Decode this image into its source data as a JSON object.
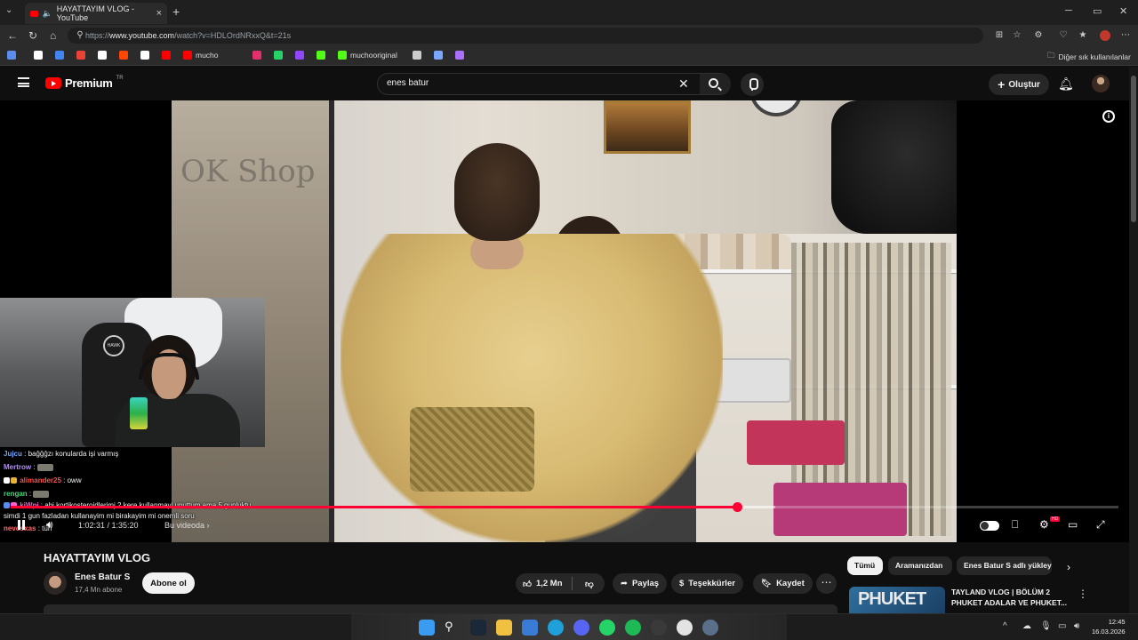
{
  "browser": {
    "tab_title": "HAYATTAYIM VLOG - YouTube",
    "url_prefix": "https://",
    "url_host": "www.youtube.com",
    "url_path": "/watch?v=HDLOrdNRxxQ&t=21s",
    "other_bookmarks": "Diğer sık kullanılanlar",
    "bookmarks": [
      {
        "label": "",
        "color": "#5a8dee"
      },
      {
        "label": "",
        "color": "#ffffff"
      },
      {
        "label": "",
        "color": "#4285f4"
      },
      {
        "label": "",
        "color": "#ea4335"
      },
      {
        "label": "",
        "color": "#ffffff"
      },
      {
        "label": "",
        "color": "#ff4500"
      },
      {
        "label": "",
        "color": "#ffffff"
      },
      {
        "label": "",
        "color": "#ff0000"
      },
      {
        "label": "mucho",
        "color": "#ff0000"
      },
      {
        "label": "",
        "color": "#e1306c"
      },
      {
        "label": "",
        "color": "#25d366"
      },
      {
        "label": "",
        "color": "#9146ff"
      },
      {
        "label": "",
        "color": "#53fc18"
      },
      {
        "label": "muchooriginal",
        "color": "#53fc18"
      },
      {
        "label": "",
        "color": "#cccccc"
      },
      {
        "label": "",
        "color": "#7aa7ff"
      },
      {
        "label": "",
        "color": "#a970ff"
      }
    ]
  },
  "youtube": {
    "logo_text": "Premium",
    "region": "TR",
    "search_value": "enes batur",
    "create_label": "Oluştur"
  },
  "player": {
    "current_time": "1:02:31",
    "duration": "1:35:20",
    "time_display": "1:02:31 / 1:35:20",
    "chapter_label": "Bu videoda",
    "played_fraction": 0.656,
    "buffered_fraction": 0.69,
    "shop_sign": "OK Shop"
  },
  "stream_overlay": {
    "chair_brand": "HAWK",
    "chat": [
      {
        "user": "Jujcu",
        "color": "#6fa8ff",
        "message": "bağğğzı konularda işi varmış",
        "emote": false
      },
      {
        "user": "Mertrow",
        "color": "#b48cff",
        "message": "",
        "emote": true
      },
      {
        "user": "alimander25",
        "color": "#ff4d4d",
        "message": "oww",
        "emote": false
      },
      {
        "user": "rengan",
        "color": "#4cd37c",
        "message": "",
        "emote": true
      },
      {
        "user": "kiWpi",
        "color": "#ff5fd2",
        "message": "abi kortikosteroidlerimj 2 kere kullanmayi unuttum ama 5 gunluktu simdi 1 gun fazladan kullanayim mi birakayim mi onemli soru",
        "emote": false
      },
      {
        "user": "nevosxas",
        "color": "#ff6b6b",
        "message": "tün",
        "emote": false
      }
    ]
  },
  "video": {
    "title": "HAYATTAYIM VLOG",
    "channel_name": "Enes Batur S",
    "subscribers": "17,4 Mn abone",
    "subscribe_label": "Abone ol",
    "likes": "1,2 Mn",
    "share_label": "Paylaş",
    "thanks_label": "Teşekkürler",
    "save_label": "Kaydet"
  },
  "sidebar": {
    "chips": [
      "Tümü",
      "Aramanızdan",
      "Enes Batur S adlı yükleyi"
    ],
    "recommended": {
      "thumb_text": "PHUKET",
      "title": "TAYLAND VLOG | BÖLÜM 2 PHUKET ADALAR VE PHUKET..."
    }
  },
  "taskbar": {
    "time": "12:45",
    "date": "16.03.2026",
    "apps": [
      {
        "name": "windows-start",
        "color": "#3a9bf0"
      },
      {
        "name": "search",
        "color": "#2a2a2a"
      },
      {
        "name": "steam",
        "color": "#1b2838"
      },
      {
        "name": "file-explorer",
        "color": "#f0c040"
      },
      {
        "name": "store",
        "color": "#3a7bd5"
      },
      {
        "name": "edge",
        "color": "#1fa0d8"
      },
      {
        "name": "discord",
        "color": "#5865f2"
      },
      {
        "name": "whatsapp",
        "color": "#25d366"
      },
      {
        "name": "spotify",
        "color": "#1db954"
      },
      {
        "name": "obs",
        "color": "#3a3a3a"
      },
      {
        "name": "chrome",
        "color": "#e3e3e3"
      },
      {
        "name": "app",
        "color": "#5a6f8a"
      }
    ]
  }
}
